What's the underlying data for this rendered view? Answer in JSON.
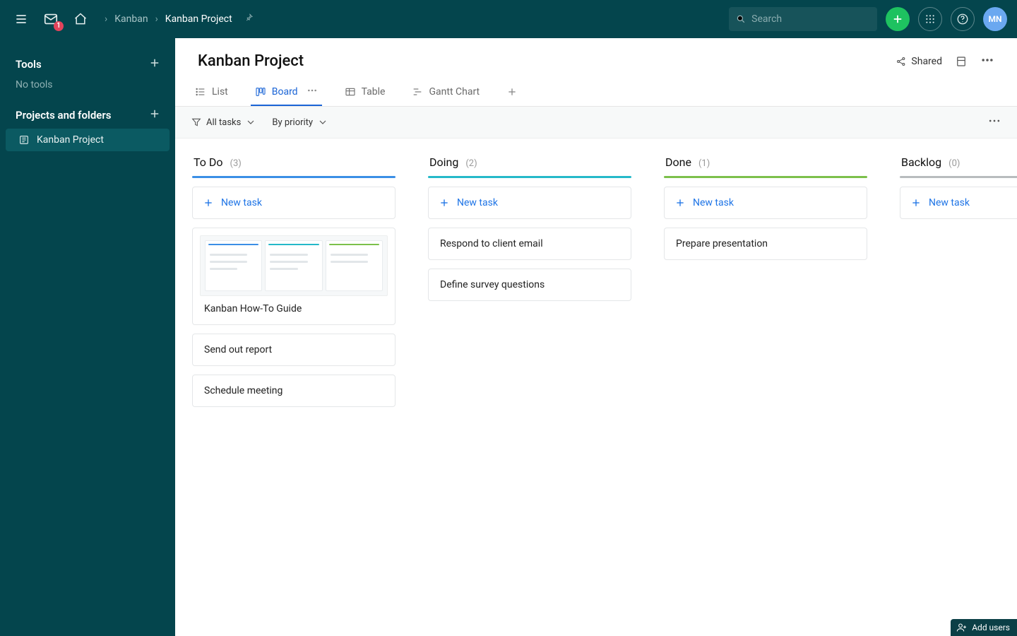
{
  "topbar": {
    "mail_badge": "1",
    "search_placeholder": "Search",
    "avatar_initials": "MN"
  },
  "breadcrumb": {
    "items": [
      "Kanban",
      "Kanban Project"
    ]
  },
  "sidebar": {
    "tools_title": "Tools",
    "no_tools": "No tools",
    "projects_title": "Projects and folders",
    "project_item": "Kanban Project"
  },
  "page": {
    "title": "Kanban Project",
    "shared_label": "Shared"
  },
  "viewtabs": {
    "list": "List",
    "board": "Board",
    "table": "Table",
    "gantt": "Gantt Chart"
  },
  "filters": {
    "all_tasks": "All tasks",
    "by_priority": "By priority"
  },
  "board": {
    "new_task_label": "New task",
    "columns": [
      {
        "title": "To Do",
        "count": "(3)",
        "accent": "#3b8fe6",
        "cards": [
          {
            "title": "Kanban How-To Guide",
            "has_thumb": true
          },
          {
            "title": "Send out report"
          },
          {
            "title": "Schedule meeting"
          }
        ]
      },
      {
        "title": "Doing",
        "count": "(2)",
        "accent": "#25b9c9",
        "cards": [
          {
            "title": "Respond to client email"
          },
          {
            "title": "Define survey questions"
          }
        ]
      },
      {
        "title": "Done",
        "count": "(1)",
        "accent": "#7cc04b",
        "cards": [
          {
            "title": "Prepare presentation"
          }
        ]
      },
      {
        "title": "Backlog",
        "count": "(0)",
        "accent": "#b8bcbe",
        "cards": []
      }
    ]
  },
  "footer": {
    "add_users": "Add users"
  }
}
